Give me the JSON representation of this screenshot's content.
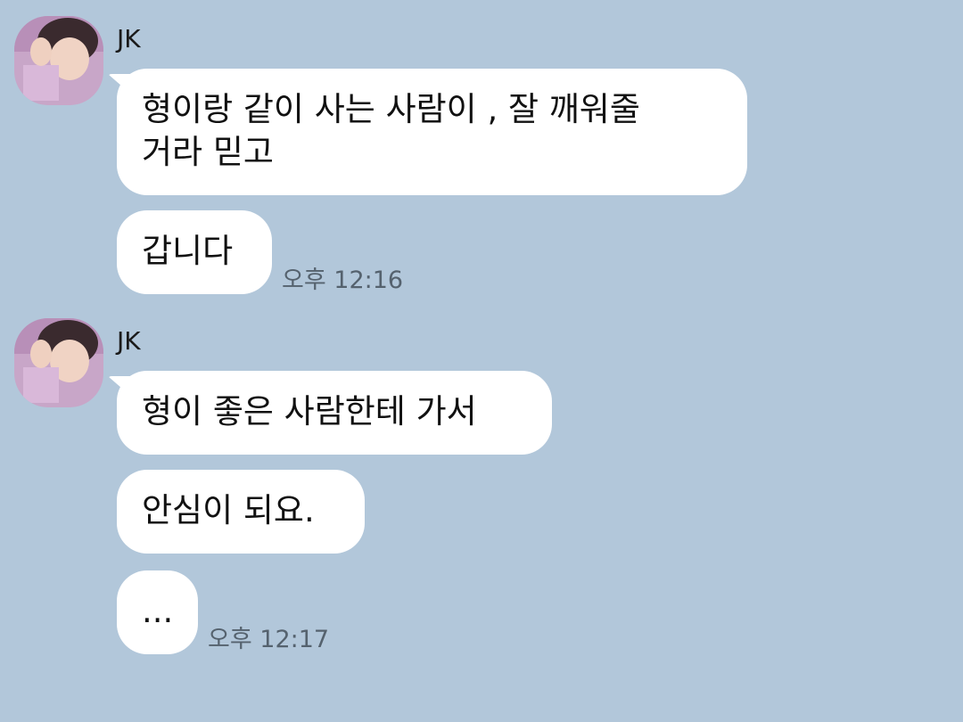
{
  "groups": [
    {
      "sender": "JK",
      "messages": [
        "형이랑 같이 사는 사람이 , 잘 깨워줄\n거라 믿고",
        "갑니다"
      ],
      "time": "오후 12:16"
    },
    {
      "sender": "JK",
      "messages": [
        "형이 좋은 사람한테 가서",
        "안심이 되요.",
        "..."
      ],
      "time": "오후 12:17"
    }
  ],
  "colors": {
    "background": "#b2c7da",
    "bubble": "#ffffff"
  },
  "icons": {
    "avatar": "profile-photo"
  }
}
